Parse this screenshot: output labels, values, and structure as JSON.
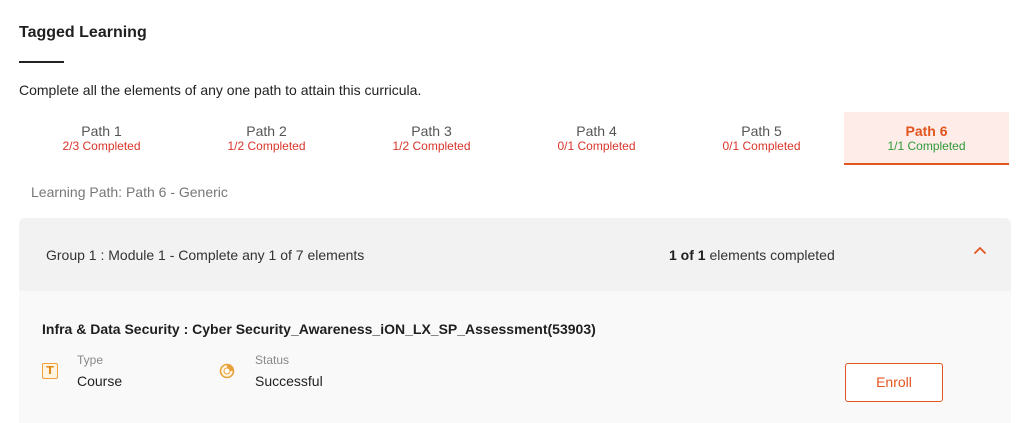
{
  "section": {
    "title": "Tagged Learning",
    "instruction": "Complete all the elements of any one path to attain this curricula."
  },
  "tabs": [
    {
      "name": "Path 1",
      "status": "2/3 Completed",
      "active": false
    },
    {
      "name": "Path 2",
      "status": "1/2 Completed",
      "active": false
    },
    {
      "name": "Path 3",
      "status": "1/2 Completed",
      "active": false
    },
    {
      "name": "Path 4",
      "status": "0/1 Completed",
      "active": false
    },
    {
      "name": "Path 5",
      "status": "0/1 Completed",
      "active": false
    },
    {
      "name": "Path 6",
      "status": "1/1 Completed",
      "active": true
    }
  ],
  "learning_path_label": "Learning Path: Path 6 - Generic",
  "group": {
    "title": "Group 1 : Module 1 - Complete any 1 of 7 elements",
    "progress_count": "1 of 1",
    "progress_suffix": " elements completed",
    "toggle_icon": "chevron-up-icon"
  },
  "element": {
    "title": "Infra & Data Security : Cyber Security_Awareness_iON_LX_SP_Assessment(53903)",
    "type_icon_glyph": "T",
    "type_label": "Type",
    "type_value": "Course",
    "status_label": "Status",
    "status_value": "Successful",
    "enroll_label": "Enroll"
  },
  "colors": {
    "accent": "#e2551f",
    "incomplete": "#d9352a",
    "complete": "#2e9a3a",
    "active_tab_bg": "#fdece8"
  }
}
